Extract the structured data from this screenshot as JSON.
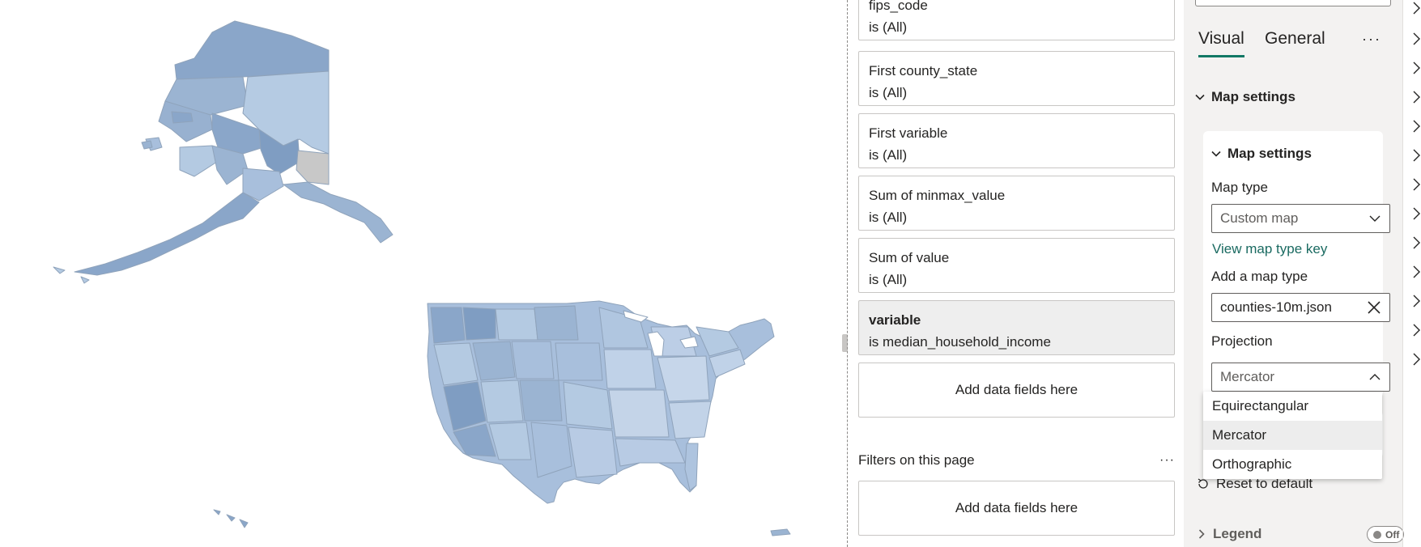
{
  "filters_pane": {
    "filters": [
      {
        "name": "fips_code",
        "value": "is (All)"
      },
      {
        "name": "First county_state",
        "value": "is (All)"
      },
      {
        "name": "First variable",
        "value": "is (All)"
      },
      {
        "name": "Sum of minmax_value",
        "value": "is (All)"
      },
      {
        "name": "Sum of value",
        "value": "is (All)"
      },
      {
        "name": "variable",
        "value": "is median_household_income"
      }
    ],
    "visual_drop_zone": "Add data fields here",
    "page_section_title": "Filters on this page",
    "page_section_more": "···",
    "page_drop_zone": "Add data fields here"
  },
  "format_pane": {
    "tabs": {
      "visual": "Visual",
      "general": "General",
      "more": "···"
    },
    "section_title": "Map settings",
    "card": {
      "title": "Map settings",
      "map_type_label": "Map type",
      "map_type_value": "Custom map",
      "map_key_link": "View map type key",
      "add_map_type_label": "Add a map type",
      "add_map_type_value": "counties-10m.json",
      "projection_label": "Projection",
      "projection_value": "Mercator",
      "projection_options": [
        "Equirectangular",
        "Mercator",
        "Orthographic"
      ],
      "selected_option_index": 1
    },
    "reset_label": "Reset to default",
    "legend": {
      "label": "Legend",
      "toggle": "Off"
    }
  },
  "colors": {
    "accent": "#117865",
    "link": "#1a6a61",
    "map_light": "#b4cae2",
    "map_mid": "#9bb4d2",
    "map_dark": "#7f9dc2",
    "map_nodata": "#c8c8c8"
  },
  "icons": [
    "chevron-down-icon",
    "chevron-up-icon",
    "chevron-right-icon",
    "close-icon",
    "reset-icon",
    "more-icon"
  ]
}
